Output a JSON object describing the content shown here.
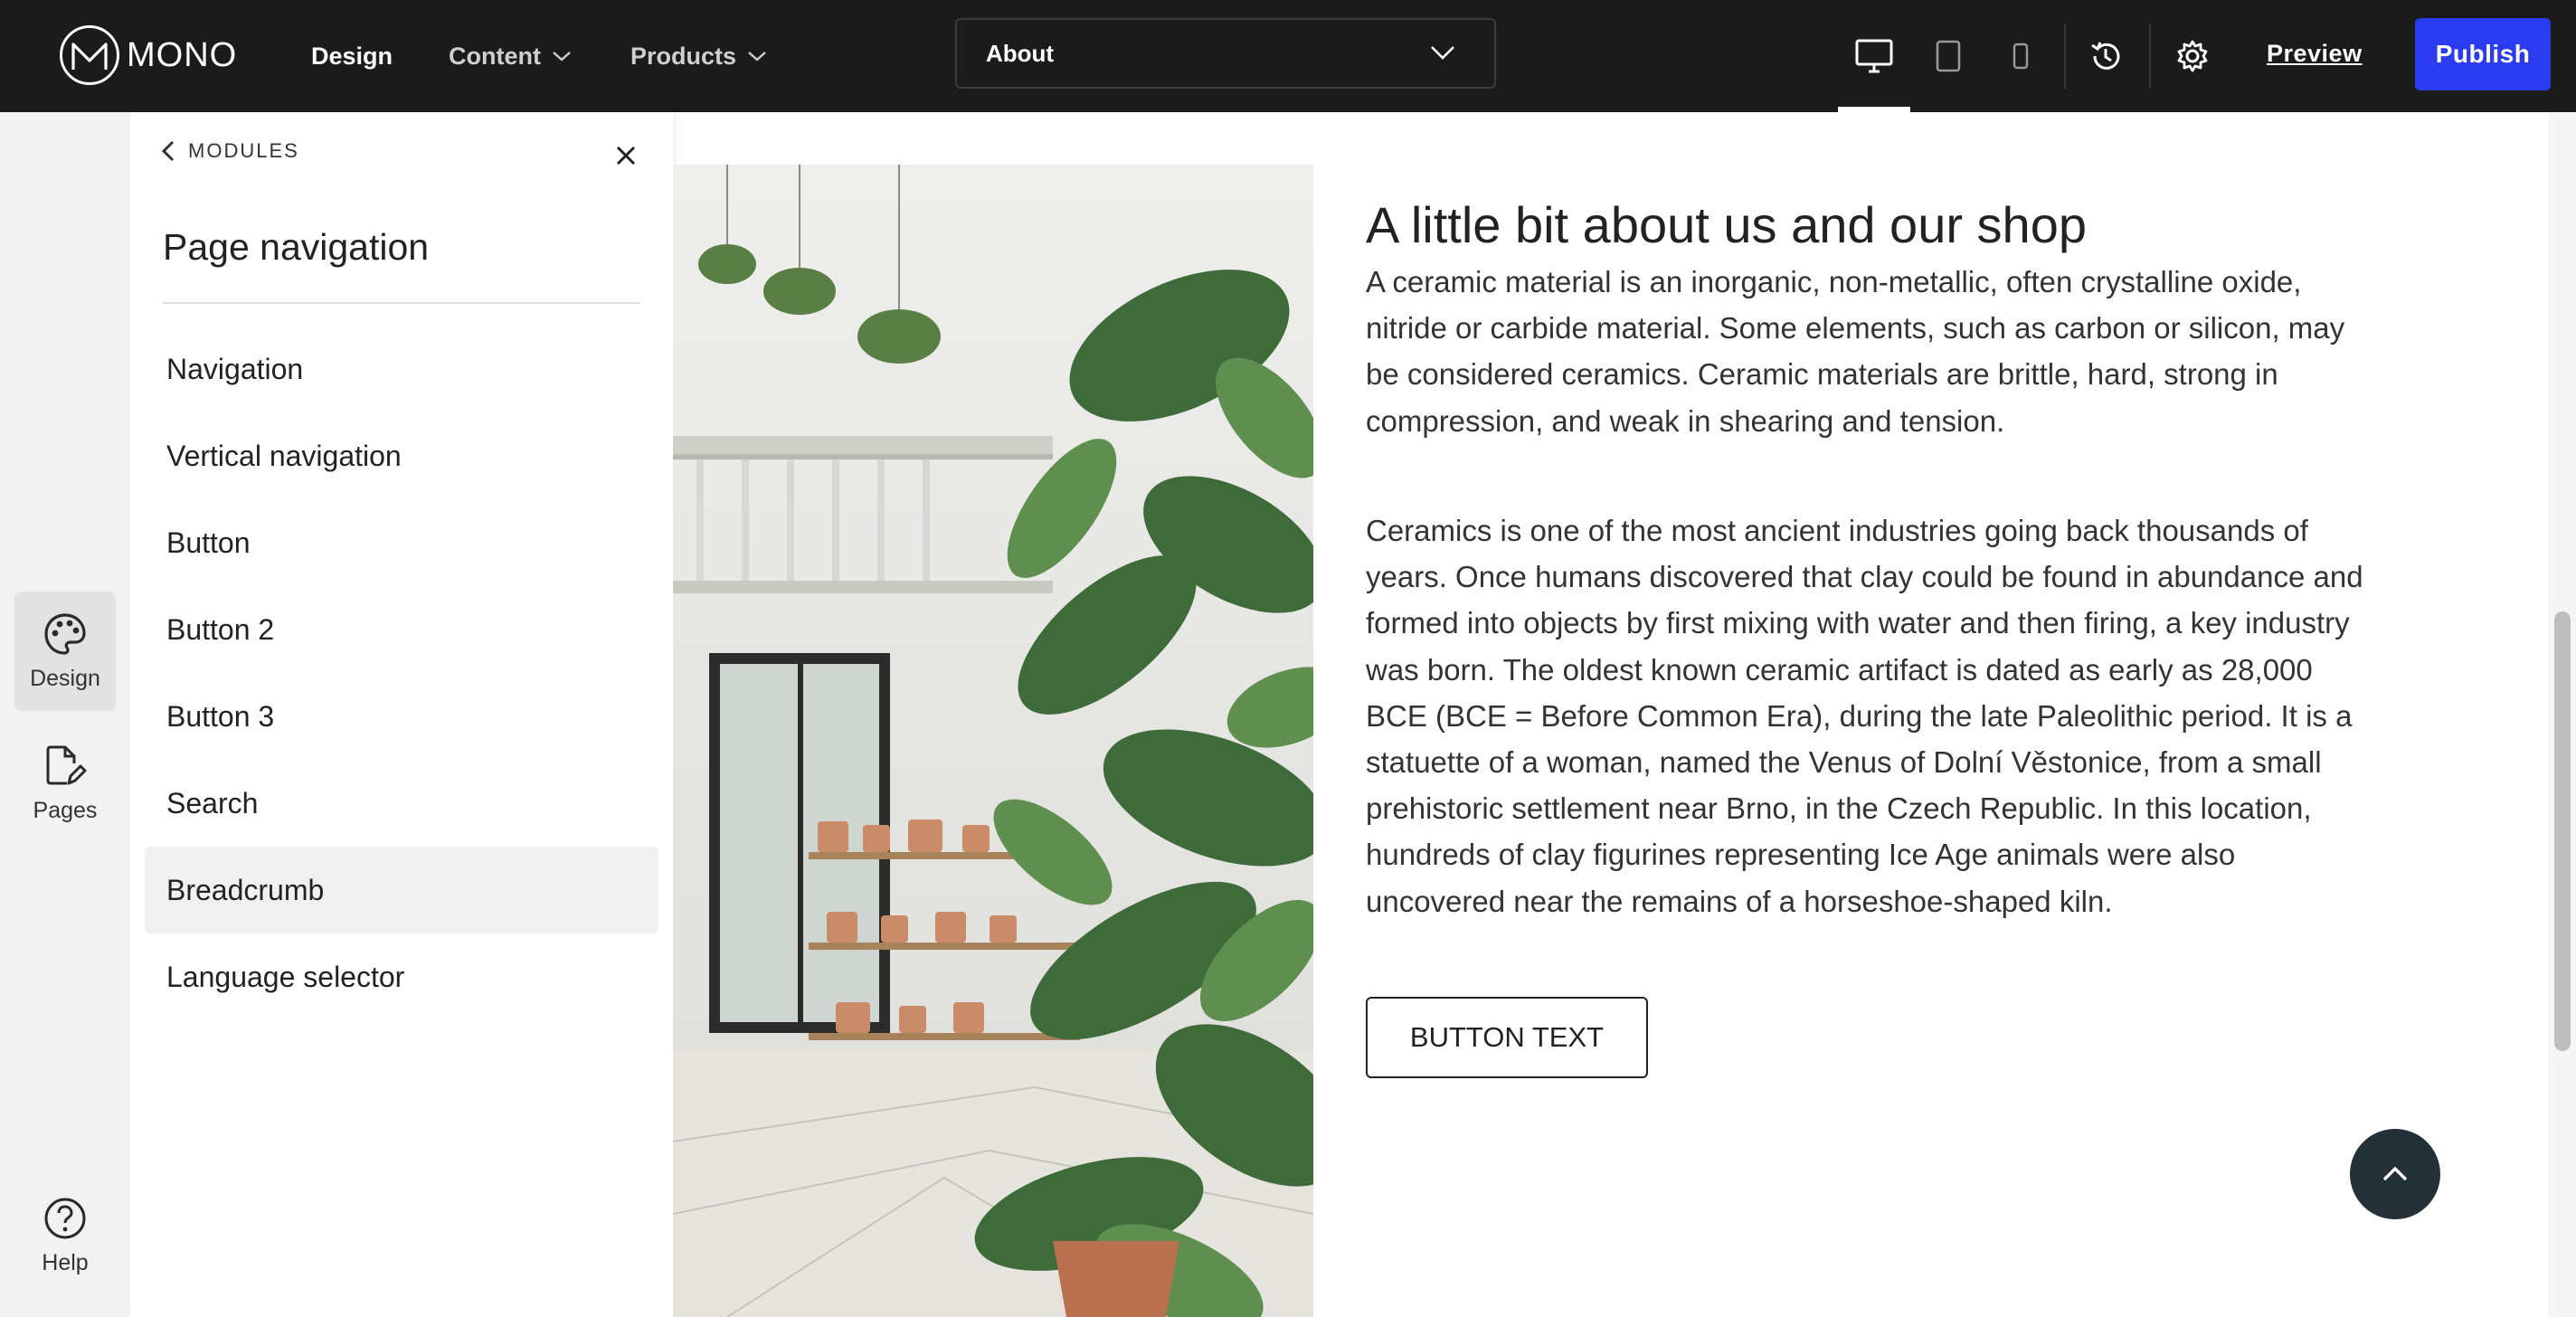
{
  "app": {
    "logo_text": "MONO"
  },
  "topbar": {
    "menu": [
      {
        "label": "Design",
        "active": true
      },
      {
        "label": "Content",
        "has_dropdown": true
      },
      {
        "label": "Products",
        "has_dropdown": true
      }
    ],
    "page_select": {
      "value": "About"
    },
    "device_icons": [
      "desktop-icon",
      "tablet-icon",
      "mobile-icon"
    ],
    "active_device": "desktop",
    "preview_label": "Preview",
    "publish_label": "Publish",
    "colors": {
      "bar": "#1b1b1b",
      "publish": "#2b3cf0"
    }
  },
  "rail": {
    "items": [
      {
        "label": "Design",
        "icon": "palette-icon",
        "active": true
      },
      {
        "label": "Pages",
        "icon": "pages-edit-icon"
      }
    ],
    "help_label": "Help"
  },
  "panel": {
    "back_label": "MODULES",
    "title": "Page navigation",
    "items": [
      {
        "label": "Navigation"
      },
      {
        "label": "Vertical navigation"
      },
      {
        "label": "Button"
      },
      {
        "label": "Button 2"
      },
      {
        "label": "Button 3"
      },
      {
        "label": "Search"
      },
      {
        "label": "Breadcrumb",
        "selected": true
      },
      {
        "label": "Language selector"
      }
    ]
  },
  "content": {
    "title": "A little bit about us and our shop",
    "paragraph1": "A ceramic material is an inorganic, non-metallic, often crystalline oxide, nitride or carbide material. Some elements, such as carbon or silicon, may be considered ceramics. Ceramic materials are brittle, hard, strong in compression, and weak in shearing and tension.",
    "paragraph2": "Ceramics is one of the most ancient industries going back thousands of years. Once humans discovered that clay could be found in abundance and formed into objects by first mixing with water and then firing, a key industry was born. The oldest known ceramic artifact is dated as early as 28,000 BCE (BCE = Before Common Era), during the late Paleolithic period. It is a statuette of a woman, named the Venus of Dolní Věstonice, from a small prehistoric settlement near Brno, in the Czech Republic. In this location, hundreds of clay figurines representing Ice Age animals were also uncovered near the remains of a horseshoe-shaped kiln.",
    "button_label": "BUTTON TEXT",
    "scroll_top_icon": "chevron-up-icon"
  }
}
